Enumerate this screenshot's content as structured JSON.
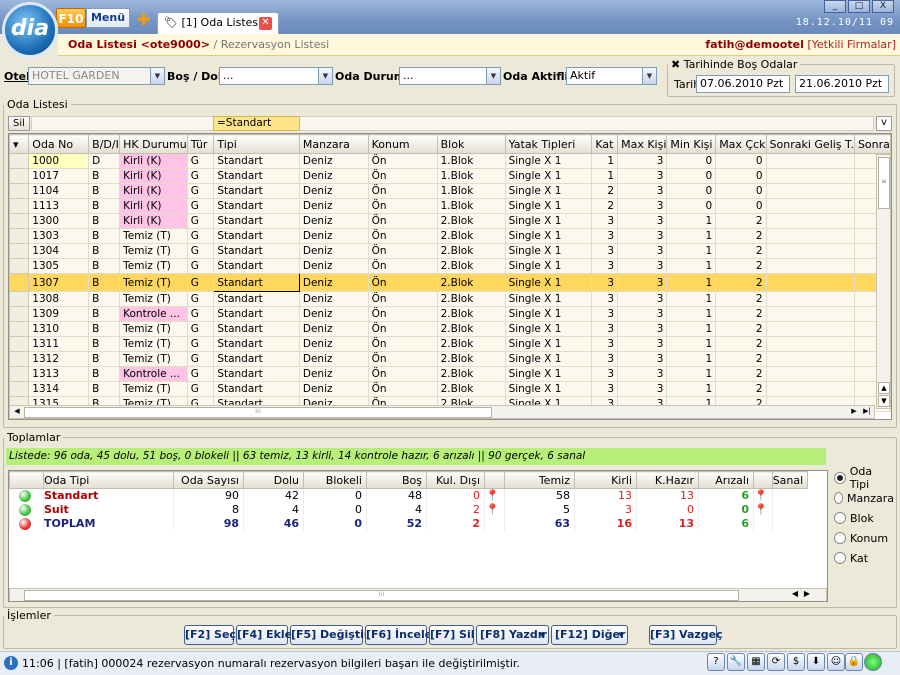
{
  "app": {
    "logo": "dia",
    "f10": "F10",
    "menu": "Menü",
    "tab_title": "[1] Oda Listesi",
    "clock": "18.12.10/11 09",
    "win_controls": [
      "_",
      "□",
      "X"
    ]
  },
  "header": {
    "title": "Oda Listesi <ote9000>",
    "separator": " / ",
    "subtitle": "Rezervasyon Listesi",
    "user": "fatih@demootel",
    "perm": "[Yetkili Firmalar]"
  },
  "filters": {
    "otel_label": "Otel",
    "otel_value": "HOTEL GARDEN",
    "bos_label": "Boş / Dolu",
    "bos_value": "...",
    "durum_label": "Oda Durumu",
    "durum_value": "...",
    "aktif_label": "Oda Aktifliği",
    "aktif_value": "Aktif",
    "tarihinde_label": "Tarihinde Boş Odalar",
    "tarih_label": "Tarih",
    "tarih_from": "07.06.2010 Pzt",
    "tarih_to": "21.06.2010 Pzt"
  },
  "list": {
    "legend": "Oda Listesi",
    "sil": "Sil",
    "filter_value": "=Standart",
    "v": "v"
  },
  "columns": [
    "Oda No",
    "B/D/I",
    "HK Durumu",
    "Tür",
    "Tipi",
    "Manzara",
    "Konum",
    "Blok",
    "Yatak Tipleri",
    "Kat",
    "Max Kişi",
    "Min Kişi",
    "Max Çck",
    "Sonraki Geliş T.",
    "Sonra"
  ],
  "rows": [
    [
      "1000",
      "D",
      "Kirli (K)",
      "G",
      "Standart",
      "Deniz",
      "Ön",
      "1.Blok",
      "Single X 1",
      "1",
      "3",
      "0",
      "0"
    ],
    [
      "1017",
      "B",
      "Kirli (K)",
      "G",
      "Standart",
      "Deniz",
      "Ön",
      "1.Blok",
      "Single X 1",
      "1",
      "3",
      "0",
      "0"
    ],
    [
      "1104",
      "B",
      "Kirli (K)",
      "G",
      "Standart",
      "Deniz",
      "Ön",
      "1.Blok",
      "Single X 1",
      "2",
      "3",
      "0",
      "0"
    ],
    [
      "1113",
      "B",
      "Kirli (K)",
      "G",
      "Standart",
      "Deniz",
      "Ön",
      "1.Blok",
      "Single X 1",
      "2",
      "3",
      "0",
      "0"
    ],
    [
      "1300",
      "B",
      "Kirli (K)",
      "G",
      "Standart",
      "Deniz",
      "Ön",
      "2.Blok",
      "Single X 1",
      "3",
      "3",
      "1",
      "2"
    ],
    [
      "1303",
      "B",
      "Temiz (T)",
      "G",
      "Standart",
      "Deniz",
      "Ön",
      "2.Blok",
      "Single X 1",
      "3",
      "3",
      "1",
      "2"
    ],
    [
      "1304",
      "B",
      "Temiz (T)",
      "G",
      "Standart",
      "Deniz",
      "Ön",
      "2.Blok",
      "Single X 1",
      "3",
      "3",
      "1",
      "2"
    ],
    [
      "1305",
      "B",
      "Temiz (T)",
      "G",
      "Standart",
      "Deniz",
      "Ön",
      "2.Blok",
      "Single X 1",
      "3",
      "3",
      "1",
      "2"
    ],
    [
      "1307",
      "B",
      "Temiz (T)",
      "G",
      "Standart",
      "Deniz",
      "Ön",
      "2.Blok",
      "Single X 1",
      "3",
      "3",
      "1",
      "2"
    ],
    [
      "1308",
      "B",
      "Temiz (T)",
      "G",
      "Standart",
      "Deniz",
      "Ön",
      "2.Blok",
      "Single X 1",
      "3",
      "3",
      "1",
      "2"
    ],
    [
      "1309",
      "B",
      "Kontrole ...",
      "G",
      "Standart",
      "Deniz",
      "Ön",
      "2.Blok",
      "Single X 1",
      "3",
      "3",
      "1",
      "2"
    ],
    [
      "1310",
      "B",
      "Temiz (T)",
      "G",
      "Standart",
      "Deniz",
      "Ön",
      "2.Blok",
      "Single X 1",
      "3",
      "3",
      "1",
      "2"
    ],
    [
      "1311",
      "B",
      "Temiz (T)",
      "G",
      "Standart",
      "Deniz",
      "Ön",
      "2.Blok",
      "Single X 1",
      "3",
      "3",
      "1",
      "2"
    ],
    [
      "1312",
      "B",
      "Temiz (T)",
      "G",
      "Standart",
      "Deniz",
      "Ön",
      "2.Blok",
      "Single X 1",
      "3",
      "3",
      "1",
      "2"
    ],
    [
      "1313",
      "B",
      "Kontrole ...",
      "G",
      "Standart",
      "Deniz",
      "Ön",
      "2.Blok",
      "Single X 1",
      "3",
      "3",
      "1",
      "2"
    ],
    [
      "1314",
      "B",
      "Temiz (T)",
      "G",
      "Standart",
      "Deniz",
      "Ön",
      "2.Blok",
      "Single X 1",
      "3",
      "3",
      "1",
      "2"
    ],
    [
      "1315",
      "B",
      "Temiz (T)",
      "G",
      "Standart",
      "Deniz",
      "Ön",
      "2.Blok",
      "Single X 1",
      "3",
      "3",
      "1",
      "2"
    ]
  ],
  "selected_row": "1307",
  "totals": {
    "legend": "Toplamlar",
    "summary": "Listede: 96 oda, 45 dolu, 51 boş, 0 blokeli || 63 temiz, 13 kirli, 14 kontrole hazır, 6 arızalı || 90 gerçek, 6 sanal",
    "columns": [
      "Oda Tipi",
      "Oda Sayısı",
      "Dolu",
      "Blokeli",
      "Boş",
      "Kul. Dışı",
      "Temiz",
      "Kirli",
      "K.Hazır",
      "Arızalı",
      "Sanal"
    ],
    "rows": [
      {
        "name": "Standart",
        "dot": "#3cbf3c",
        "vals": [
          "90",
          "42",
          "0",
          "48",
          "0",
          "58",
          "13",
          "13",
          "6"
        ]
      },
      {
        "name": "Suit",
        "dot": "#3cbf3c",
        "vals": [
          "8",
          "4",
          "0",
          "4",
          "2",
          "5",
          "3",
          "0",
          "0"
        ]
      },
      {
        "name": "TOPLAM",
        "dot": "#e03030",
        "vals": [
          "98",
          "46",
          "0",
          "52",
          "2",
          "63",
          "16",
          "13",
          "6"
        ]
      }
    ],
    "group_by": [
      "Oda Tipi",
      "Manzara",
      "Blok",
      "Konum",
      "Kat"
    ],
    "group_selected": "Oda Tipi"
  },
  "actions": {
    "legend": "İşlemler",
    "buttons": [
      "[F2] Seç",
      "[F4] Ekle",
      "[F5] Değiştir",
      "[F6] İncele",
      "[F7] Sil",
      "[F8] Yazdır",
      "[F12] Diğer",
      "[F3] Vazgeç"
    ]
  },
  "status": {
    "text": "11:06 | [fatih] 000024 rezervasyon numaralı rezervasyon bilgileri başarı ile değiştirilmiştir."
  }
}
